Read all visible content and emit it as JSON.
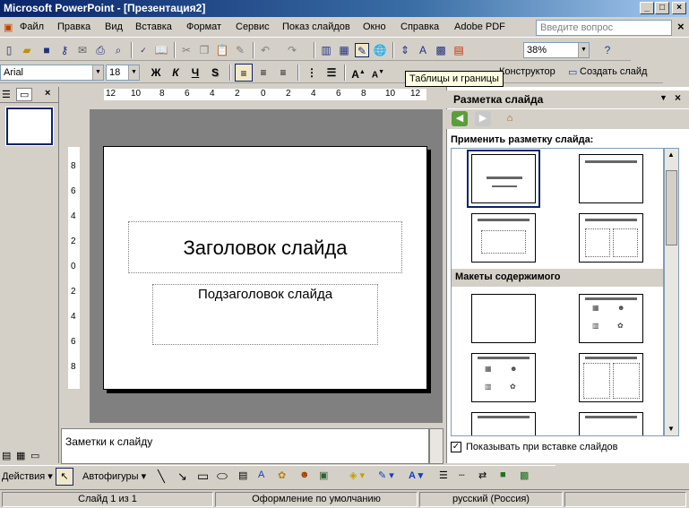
{
  "window": {
    "title": "Microsoft PowerPoint - [Презентация2]"
  },
  "menu": {
    "items": [
      "Файл",
      "Правка",
      "Вид",
      "Вставка",
      "Формат",
      "Сервис",
      "Показ слайдов",
      "Окно",
      "Справка",
      "Adobe PDF"
    ],
    "ask_placeholder": "Введите вопрос"
  },
  "standard_toolbar": {
    "zoom": "38%"
  },
  "formatting_toolbar": {
    "font": "Arial",
    "size": "18",
    "bold": "Ж",
    "italic": "К",
    "underline": "Ч",
    "shadow": "S",
    "designer": "Конструктор",
    "new_slide": "Создать слайд"
  },
  "tooltip": "Таблицы и границы",
  "rulers": {
    "horizontal": [
      "12",
      "10",
      "8",
      "6",
      "4",
      "2",
      "0",
      "2",
      "4",
      "6",
      "8",
      "10",
      "12"
    ],
    "vertical": [
      "8",
      "6",
      "4",
      "2",
      "0",
      "2",
      "4",
      "6",
      "8"
    ]
  },
  "slide": {
    "title_placeholder": "Заголовок слайда",
    "subtitle_placeholder": "Подзаголовок слайда"
  },
  "notes": {
    "text": "Заметки к слайду"
  },
  "task_pane": {
    "title": "Разметка слайда",
    "apply_label": "Применить разметку слайда:",
    "section_content": "Макеты содержимого",
    "show_on_insert": "Показывать при вставке слайдов"
  },
  "drawing_toolbar": {
    "actions": "Действия",
    "autoshapes": "Автофигуры"
  },
  "status": {
    "slide": "Слайд 1 из 1",
    "design": "Оформление по умолчанию",
    "language": "русский (Россия)"
  }
}
